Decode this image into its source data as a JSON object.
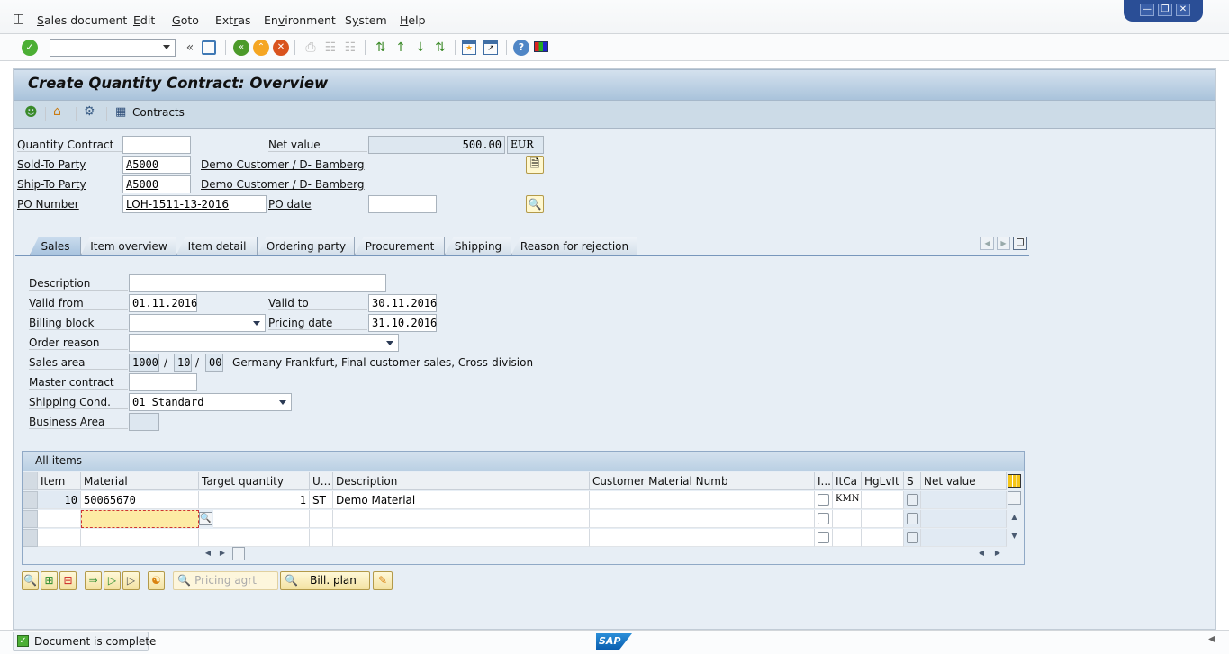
{
  "menubar": {
    "items": [
      "Sales document",
      "Edit",
      "Goto",
      "Extras",
      "Environment",
      "System",
      "Help"
    ],
    "mnemonic_index": [
      0,
      0,
      0,
      3,
      2,
      1,
      0
    ]
  },
  "window_controls": {
    "minimize": "minimize-icon",
    "restore": "restore-icon",
    "close": "close-icon"
  },
  "toolbar": {
    "command_field_value": "",
    "icons": [
      "enter-icon",
      "command-field",
      "collapse-icon",
      "save-icon",
      "back-icon",
      "exit-icon",
      "cancel-icon",
      "print-icon",
      "find-icon",
      "find-next-icon",
      "first-page-icon",
      "previous-page-icon",
      "next-page-icon",
      "last-page-icon",
      "create-session-icon",
      "shortcut-icon",
      "help-icon",
      "customize-layout-icon"
    ]
  },
  "page": {
    "title": "Create Quantity Contract: Overview"
  },
  "app_toolbar": {
    "contracts_label": "Contracts"
  },
  "header": {
    "quantity_contract_label": "Quantity Contract",
    "quantity_contract_value": "",
    "net_value_label": "Net value",
    "net_value": "500.00",
    "currency": "EUR",
    "sold_to_label": "Sold-To Party",
    "sold_to_value": "A5000",
    "sold_to_name": "Demo Customer / D- Bamberg",
    "ship_to_label": "Ship-To Party",
    "ship_to_value": "A5000",
    "ship_to_name": "Demo Customer / D- Bamberg",
    "po_number_label": "PO Number",
    "po_number_value": "LOH-1511-13-2016",
    "po_date_label": "PO date",
    "po_date_value": ""
  },
  "tabs": [
    {
      "label": "Sales",
      "active": true
    },
    {
      "label": "Item overview",
      "active": false
    },
    {
      "label": "Item detail",
      "active": false
    },
    {
      "label": "Ordering party",
      "active": false
    },
    {
      "label": "Procurement",
      "active": false
    },
    {
      "label": "Shipping",
      "active": false
    },
    {
      "label": "Reason for rejection",
      "active": false
    }
  ],
  "sales": {
    "description_label": "Description",
    "description_value": "",
    "valid_from_label": "Valid from",
    "valid_from_value": "01.11.2016",
    "valid_to_label": "Valid to",
    "valid_to_value": "30.11.2016",
    "billing_block_label": "Billing block",
    "billing_block_value": "",
    "pricing_date_label": "Pricing date",
    "pricing_date_value": "31.10.2016",
    "order_reason_label": "Order reason",
    "order_reason_value": "",
    "sales_area_label": "Sales area",
    "sales_org": "1000",
    "distr_channel": "10",
    "division": "00",
    "sales_area_sep": "/",
    "sales_area_text": "Germany Frankfurt, Final customer sales, Cross-division",
    "master_contract_label": "Master contract",
    "master_contract_value": "",
    "shipping_cond_label": "Shipping Cond.",
    "shipping_cond_value": "01 Standard",
    "business_area_label": "Business Area",
    "business_area_value": ""
  },
  "items_table": {
    "title": "All items",
    "columns": [
      "Item",
      "Material",
      "Target quantity",
      "U...",
      "Description",
      "Customer Material Numb",
      "I...",
      "ItCa",
      "HgLvIt",
      "S",
      "Net value"
    ],
    "rows": [
      {
        "item": "10",
        "material": "50065670",
        "target_qty": "1",
        "unit": "ST",
        "description": "Demo Material",
        "cust_mat": "",
        "i": false,
        "itca": "KMN",
        "hglvit": "",
        "s": false,
        "net_value": ""
      },
      {
        "item": "",
        "material": "",
        "target_qty": "",
        "unit": "",
        "description": "",
        "cust_mat": "",
        "i": false,
        "itca": "",
        "hglvit": "",
        "s": false,
        "net_value": ""
      },
      {
        "item": "",
        "material": "",
        "target_qty": "",
        "unit": "",
        "description": "",
        "cust_mat": "",
        "i": false,
        "itca": "",
        "hglvit": "",
        "s": false,
        "net_value": ""
      }
    ]
  },
  "bottom_buttons": {
    "pricing_agrt": "Pricing agrt",
    "bill_plan": "Bill. plan"
  },
  "status": {
    "message": "Document is complete",
    "type": "success"
  },
  "brand": "SAP"
}
